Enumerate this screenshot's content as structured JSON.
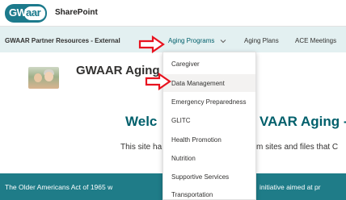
{
  "header": {
    "logo_left": "GW",
    "logo_right": "aar",
    "app_name": "SharePoint"
  },
  "nav": {
    "partner": "GWAAR Partner Resources - External",
    "aging_programs": "Aging Programs",
    "aging_plans": "Aging Plans",
    "ace_meetings": "ACE Meetings"
  },
  "hero": {
    "site_title": "GWAAR Aging -",
    "welcome_left": "Welc",
    "welcome_right": "VAAR Aging -",
    "desc_left": "This site ha",
    "desc_right": "m sites and files that C"
  },
  "footer": {
    "text_left": "The Older Americans Act of 1965 w",
    "text_right": "initiative aimed at pr"
  },
  "dropdown": {
    "items": [
      "Caregiver",
      "Data Management",
      "Emergency Preparedness",
      "GLITC",
      "Health Promotion",
      "Nutrition",
      "Supportive Services",
      "Transportation"
    ],
    "highlighted_index": 1
  },
  "colors": {
    "brand": "#1c7a8c",
    "nav_bg": "#e3f0f1",
    "footer_bg": "#1f7c88",
    "arrow": "#e8131f"
  }
}
